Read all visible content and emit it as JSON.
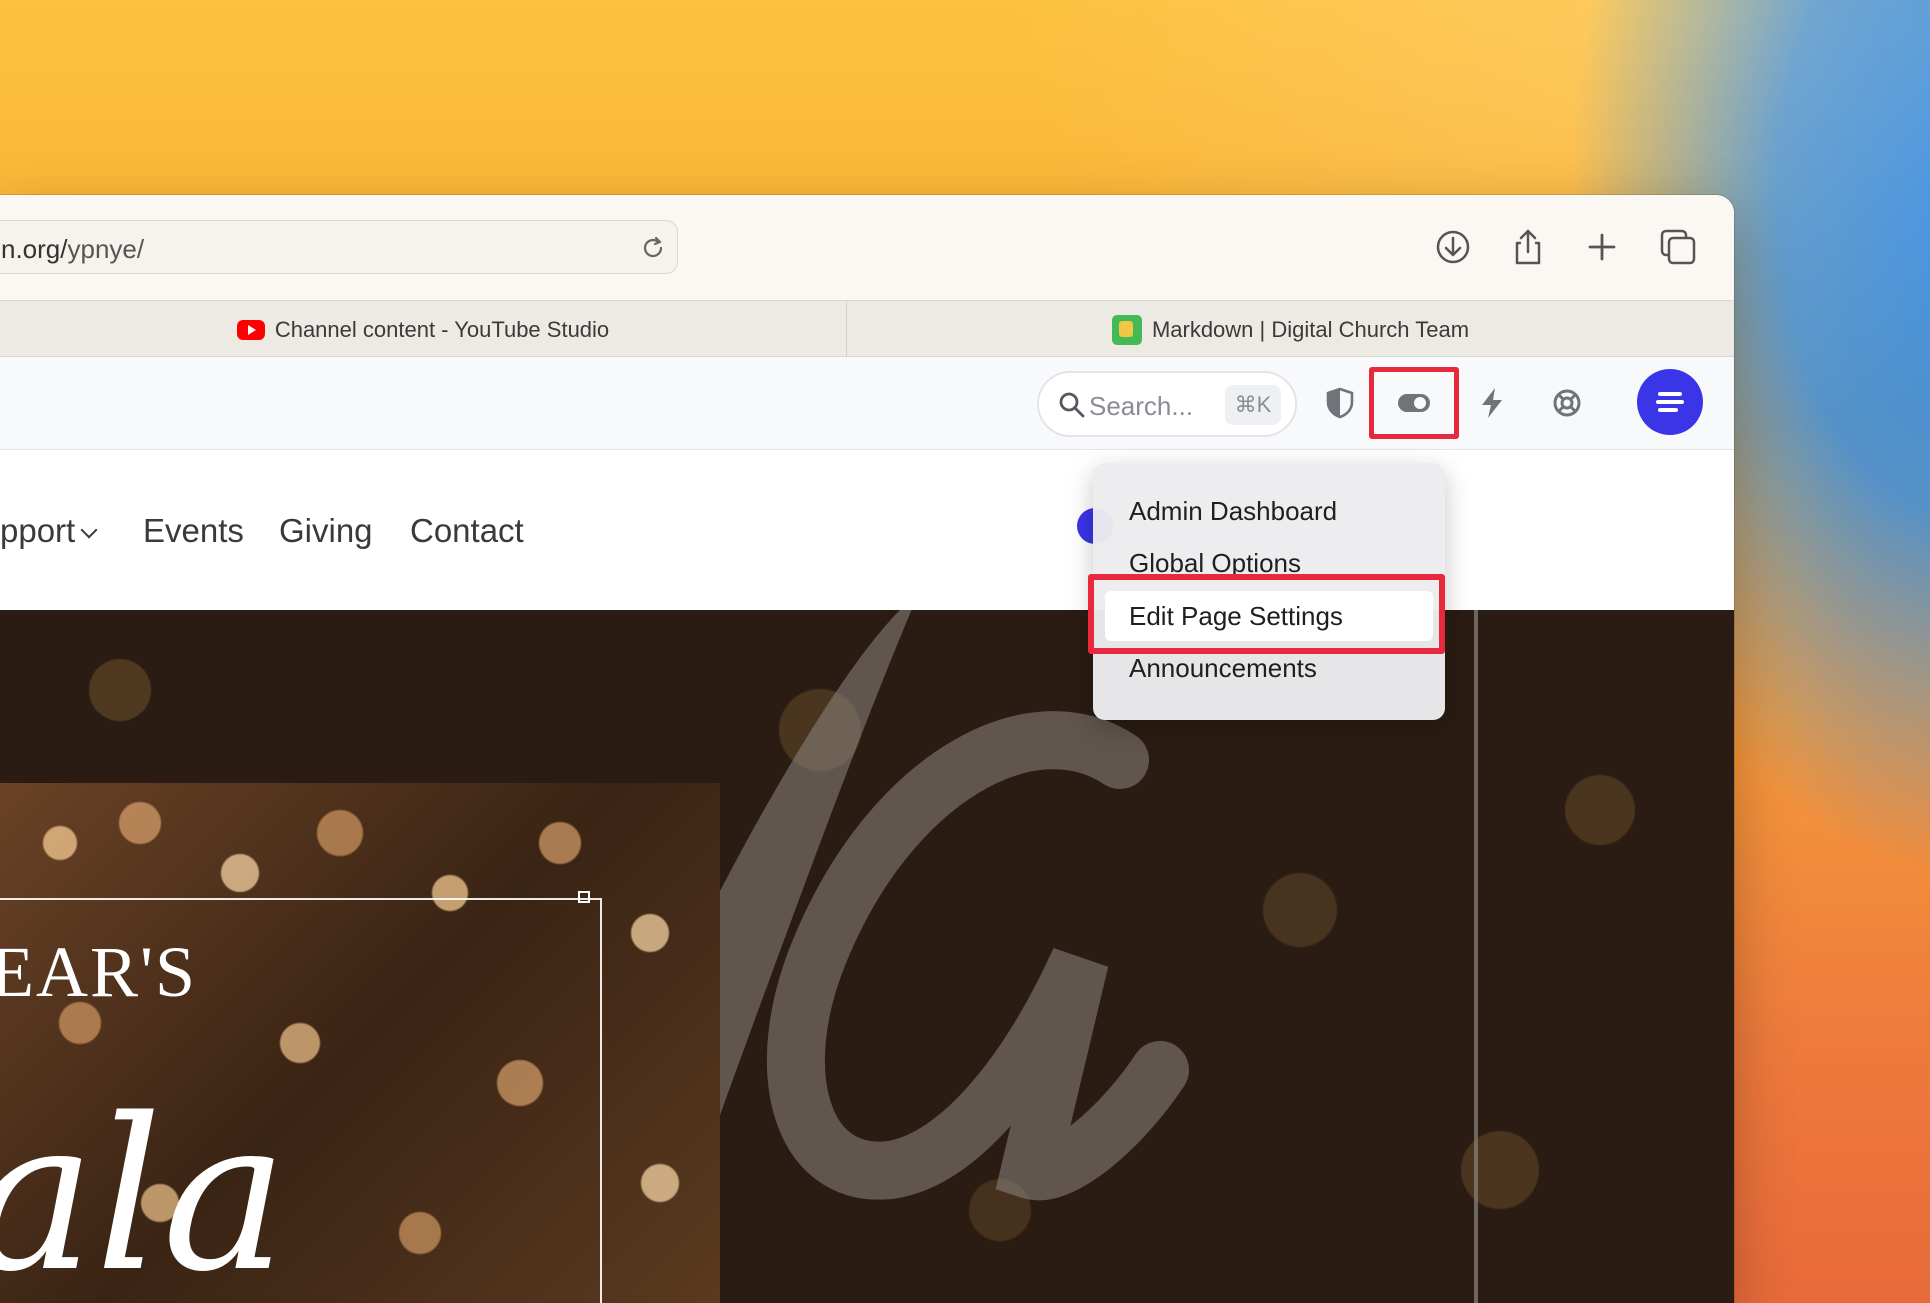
{
  "browser": {
    "address": {
      "host": "n.org/",
      "path": "ypnye/"
    },
    "tabs": [
      {
        "label": "Channel content - YouTube Studio"
      },
      {
        "label": "Markdown | Digital Church Team"
      }
    ]
  },
  "adminbar": {
    "search_placeholder": "Search...",
    "search_shortcut": "⌘K"
  },
  "site_nav": {
    "items": [
      {
        "label": "pport"
      },
      {
        "label": "Events"
      },
      {
        "label": "Giving"
      },
      {
        "label": "Contact"
      }
    ]
  },
  "dropdown": {
    "items": [
      {
        "label": "Admin Dashboard"
      },
      {
        "label": "Global Options"
      },
      {
        "label": "Edit Page Settings"
      },
      {
        "label": "Announcements"
      }
    ]
  },
  "hero": {
    "flyer_title": "EAR'S",
    "flyer_script": "ala"
  },
  "colors": {
    "highlight": "#e8283c",
    "admin_accent": "#3a35e6"
  }
}
